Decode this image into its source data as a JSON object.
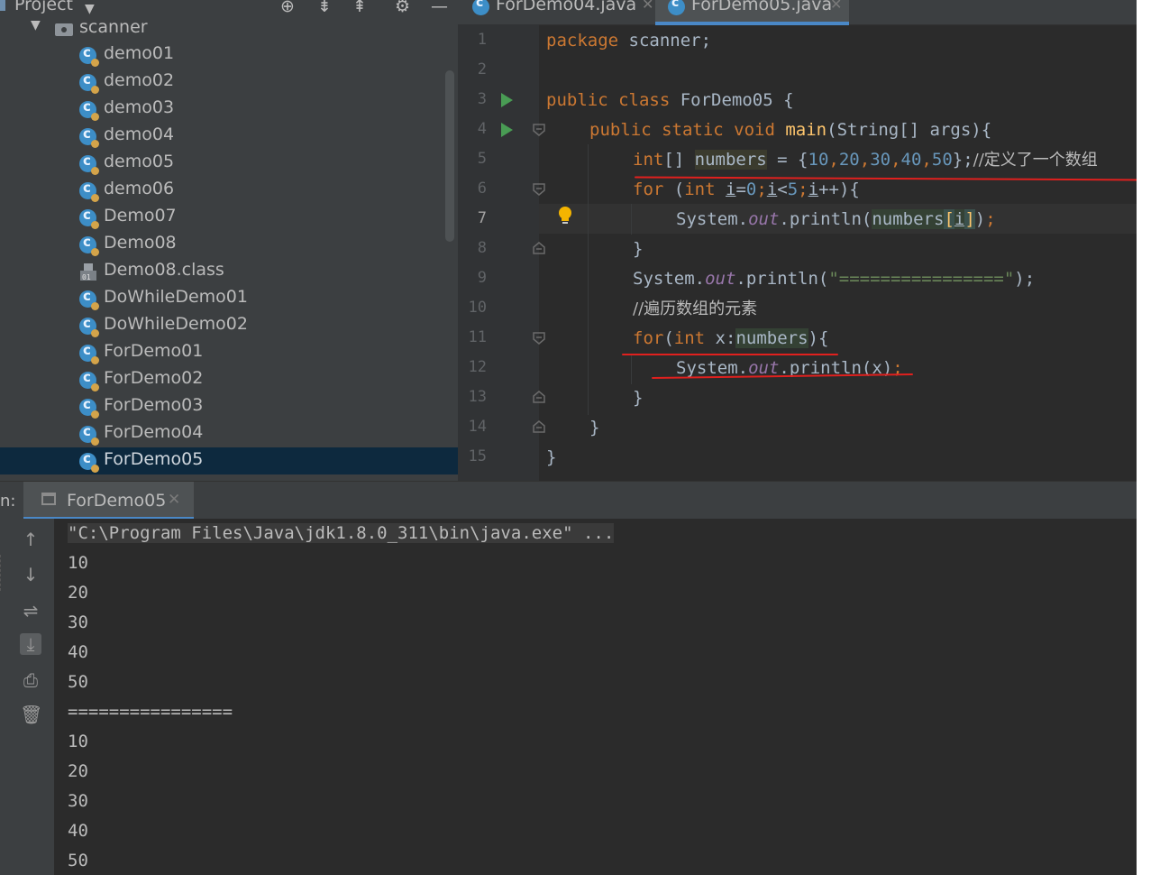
{
  "project_panel": {
    "title": "Project",
    "root_folder": "scanner",
    "files": [
      {
        "name": "demo01",
        "type": "class"
      },
      {
        "name": "demo02",
        "type": "class"
      },
      {
        "name": "demo03",
        "type": "class"
      },
      {
        "name": "demo04",
        "type": "class"
      },
      {
        "name": "demo05",
        "type": "class"
      },
      {
        "name": "demo06",
        "type": "class"
      },
      {
        "name": "Demo07",
        "type": "class"
      },
      {
        "name": "Demo08",
        "type": "class"
      },
      {
        "name": "Demo08.class",
        "type": "classfile"
      },
      {
        "name": "DoWhileDemo01",
        "type": "class"
      },
      {
        "name": "DoWhileDemo02",
        "type": "class"
      },
      {
        "name": "ForDemo01",
        "type": "class"
      },
      {
        "name": "ForDemo02",
        "type": "class"
      },
      {
        "name": "ForDemo03",
        "type": "class"
      },
      {
        "name": "ForDemo04",
        "type": "class"
      },
      {
        "name": "ForDemo05",
        "type": "class",
        "selected": true
      }
    ]
  },
  "editor": {
    "tabs": [
      {
        "label": "ForDemo04.java",
        "active": false
      },
      {
        "label": "ForDemo05.java",
        "active": true
      }
    ],
    "line_numbers": [
      "1",
      "2",
      "3",
      "4",
      "5",
      "6",
      "7",
      "8",
      "9",
      "10",
      "11",
      "12",
      "13",
      "14",
      "15"
    ],
    "current_line": "7",
    "code": {
      "l1_kw": "package",
      "l1_rest": " scanner;",
      "l3_kw": "public class",
      "l3_rest": " ForDemo05 {",
      "l4_kw": "public static void",
      "l4_fn": "main",
      "l4_rest": "(String[] args){",
      "l5_kw": "int",
      "l5_a": "[] ",
      "l5_var": "numbers",
      "l5_b": " = {",
      "l5_nums": [
        "10",
        "20",
        "30",
        "40",
        "50"
      ],
      "l5_end": "};",
      "l5_comment": "//定义了一个数组",
      "l6_kw": "for",
      "l6_a": " (",
      "l6_kw2": "int",
      "l6_b": " ",
      "l6_i1": "i",
      "l6_c": "=",
      "l6_n0": "0",
      "l6_d": ";",
      "l6_i2": "i",
      "l6_e": "<",
      "l6_n5": "5",
      "l6_f": ";",
      "l6_i3": "i",
      "l6_g": "++){",
      "l7_a": "System.",
      "l7_out": "out",
      "l7_b": ".println(",
      "l7_var": "numbers",
      "l7_br1": "[",
      "l7_i": "i",
      "l7_br2": "]",
      "l7_c": ")",
      "l7_semi": ";",
      "l8": "}",
      "l9_a": "System.",
      "l9_out": "out",
      "l9_b": ".println(",
      "l9_str": "\"================\"",
      "l9_c": ");",
      "l10_comment": "//遍历数组的元素",
      "l11_kw": "for",
      "l11_a": "(",
      "l11_kw2": "int",
      "l11_b": " x:",
      "l11_var": "numbers",
      "l11_c": "){",
      "l12_a": "System.",
      "l12_out": "out",
      "l12_b": ".println(x)",
      "l12_semi": ";",
      "l13": "}",
      "l14": "}",
      "l15": "}"
    }
  },
  "run_panel": {
    "label": "n:",
    "tab_label": "ForDemo05",
    "command": "\"C:\\Program Files\\Java\\jdk1.8.0_311\\bin\\java.exe\" ...",
    "output": [
      "10",
      "20",
      "30",
      "40",
      "50",
      "================",
      "10",
      "20",
      "30",
      "40",
      "50"
    ]
  },
  "colors": {
    "keyword": "#cc7832",
    "number": "#6897bb",
    "string": "#6a8759",
    "static_field": "#9876aa",
    "method": "#ffc66d",
    "annotation_red": "#e0201e",
    "selection": "#0d293e"
  }
}
